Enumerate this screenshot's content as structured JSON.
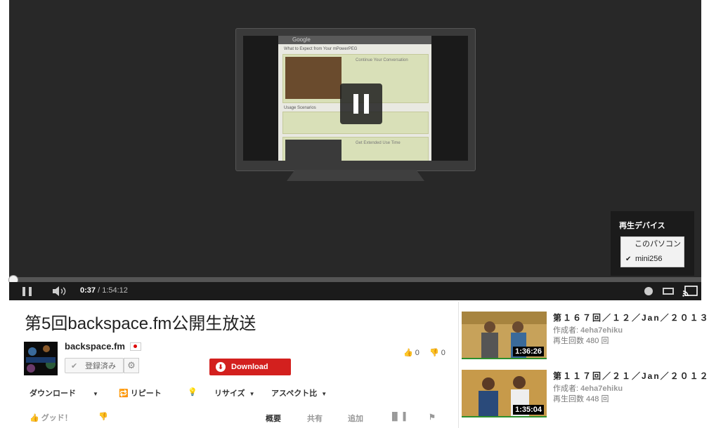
{
  "player": {
    "time_current": "0:37",
    "time_sep": " / ",
    "time_total": "1:54:12",
    "progress": 0.005,
    "device_menu": {
      "title": "再生デバイス",
      "options": [
        "このパソコン",
        "mini256"
      ],
      "selected": "mini256"
    },
    "screen": {
      "browser_title": "Google",
      "heading1": "What to Expect from Your mPowerPEG",
      "heading2": "Continue Your Conversation",
      "heading3": "Usage Scenarios",
      "heading4": "Get Extended Use Time"
    }
  },
  "video": {
    "title": "第5回backspace.fm公開生放送",
    "channel": "backspace.fm",
    "subscribe_label": "登録済み",
    "download_label": "Download",
    "likes": "0",
    "dislikes": "0"
  },
  "actions": {
    "download": "ダウンロード",
    "repeat": "リピート",
    "resize": "リサイズ",
    "aspect": "アスペクト比",
    "like": "グッド！"
  },
  "tabs": [
    "概要",
    "共有",
    "追加"
  ],
  "related": [
    {
      "title": "第１６７回／１２／Jan／２０１３",
      "author_label": "作成者:",
      "author": "4eha7ehiku",
      "views": "再生回数 480 回",
      "duration": "1:36:26"
    },
    {
      "title": "第１１７回／２１／Jan／２０１２",
      "author_label": "作成者:",
      "author": "4eha7ehiku",
      "views": "再生回数 448 回",
      "duration": "1:35:04"
    }
  ],
  "colors": {
    "accent_red": "#d3201e",
    "player_bg": "#282828",
    "watched_bar": "#2d8f2d"
  }
}
